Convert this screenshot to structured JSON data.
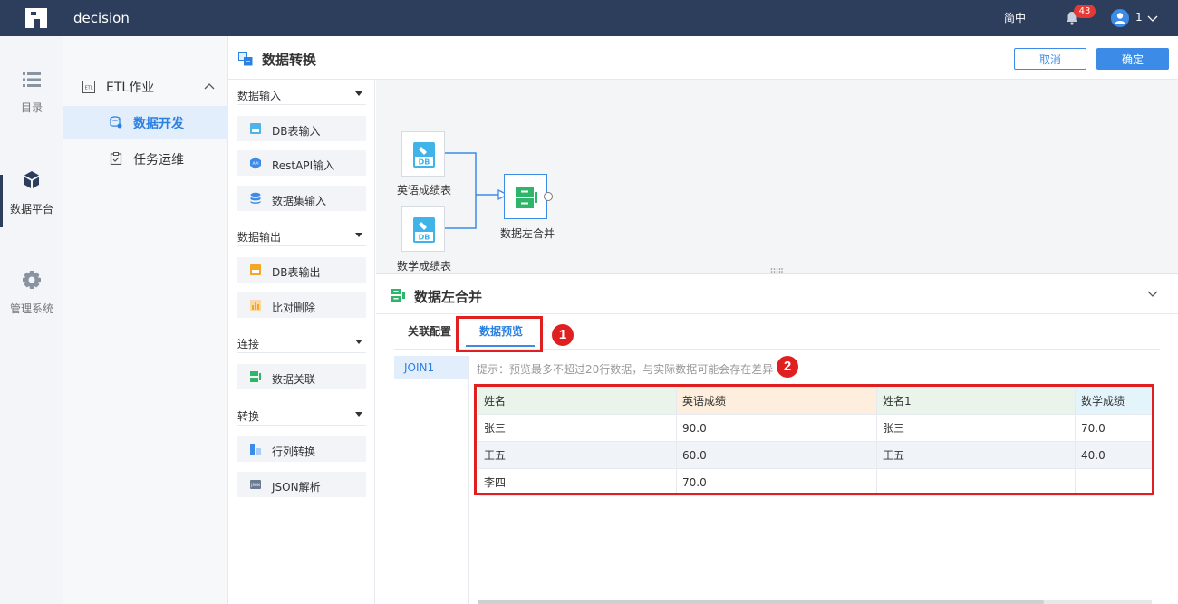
{
  "topbar": {
    "app_title": "decision",
    "lang": "简中",
    "notification_count": "43",
    "user": "1"
  },
  "rail": {
    "items": [
      {
        "label": "目录",
        "icon": "list-icon"
      },
      {
        "label": "数据平台",
        "icon": "cube-icon",
        "active": true
      },
      {
        "label": "管理系统",
        "icon": "gear-icon"
      }
    ]
  },
  "nav2": {
    "group": "ETL作业",
    "items": [
      {
        "label": "数据开发",
        "active": true
      },
      {
        "label": "任务运维"
      }
    ]
  },
  "header": {
    "title": "数据转换",
    "cancel": "取消",
    "confirm": "确定"
  },
  "palette": {
    "sections": [
      {
        "label": "数据输入",
        "items": [
          "DB表输入",
          "RestAPI输入",
          "数据集输入"
        ]
      },
      {
        "label": "数据输出",
        "items": [
          "DB表输出",
          "比对删除"
        ]
      },
      {
        "label": "连接",
        "items": [
          "数据关联"
        ]
      },
      {
        "label": "转换",
        "items": [
          "行列转换",
          "JSON解析"
        ]
      }
    ]
  },
  "canvas": {
    "nodes": [
      {
        "label": "英语成绩表",
        "icon_text": "DB"
      },
      {
        "label": "数学成绩表",
        "icon_text": "DB"
      },
      {
        "label": "数据左合并"
      }
    ]
  },
  "panel": {
    "title": "数据左合并",
    "tabs": [
      "关联配置",
      "数据预览"
    ],
    "active_tab": "数据预览",
    "markers": [
      "1",
      "2"
    ],
    "side_item": "JOIN1",
    "hint": "提示：预览最多不超过20行数据，与实际数据可能会存在差异",
    "table": {
      "headers": [
        "姓名",
        "英语成绩",
        "姓名1",
        "数学成绩"
      ],
      "rows": [
        [
          "张三",
          "90.0",
          "张三",
          "70.0"
        ],
        [
          "王五",
          "60.0",
          "王五",
          "40.0"
        ],
        [
          "李四",
          "70.0",
          "",
          ""
        ]
      ]
    }
  },
  "colors": {
    "topbar": "#2c3e5c",
    "accent": "#3c8ce7",
    "annotation": "#e02020"
  }
}
